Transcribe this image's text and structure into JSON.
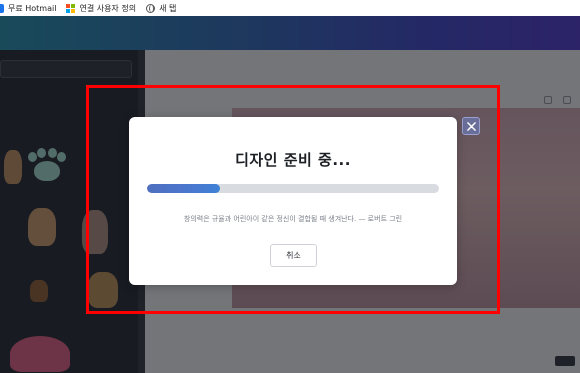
{
  "bookmarks": [
    {
      "label": "무료 Hotmail",
      "icon": "bookmark-icon"
    },
    {
      "label": "연결 사용자 정의",
      "icon": "microsoft-icon"
    },
    {
      "label": "새 탭",
      "icon": "globe-icon"
    }
  ],
  "dialog": {
    "title": "디자인 준비 중...",
    "progress": 0.25,
    "quote": "창의력은 규율과 어린아이 같은 정신이 결합될 때 생겨난다. — 로버트 그린",
    "cancel_label": "취소"
  },
  "colors": {
    "header_start": "#1f8aa6",
    "header_end": "#4a34c6",
    "progress_fill": "#4a78cf",
    "highlight": "#ff0000",
    "sidebar": "#1e2329"
  }
}
